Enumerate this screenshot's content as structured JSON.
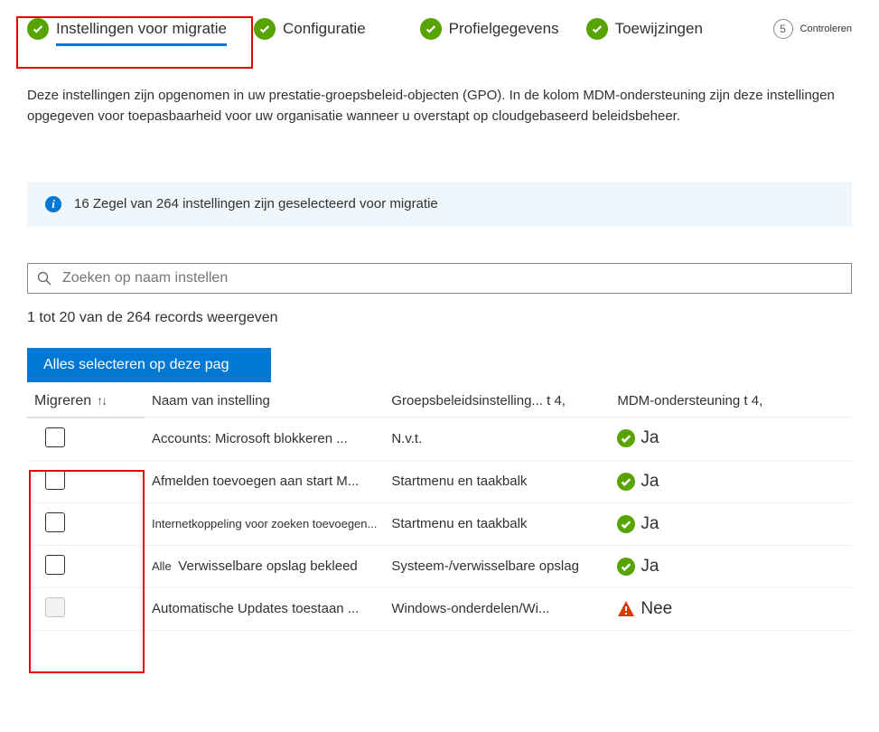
{
  "stepper": {
    "steps": [
      {
        "label": "Instellingen voor migratie",
        "done": true,
        "active": true
      },
      {
        "label": "Configuratie",
        "done": true
      },
      {
        "label": "Profielgegevens",
        "done": true
      },
      {
        "label": "Toewijzingen",
        "done": true
      },
      {
        "label": "Controleren",
        "number": "5"
      }
    ]
  },
  "description": "Deze instellingen zijn opgenomen in uw prestatie-groepsbeleid-objecten (GPO). In de kolom MDM-ondersteuning zijn deze instellingen opgegeven voor toepasbaarheid voor uw organisatie wanneer u overstapt op cloudgebaseerd beleidsbeheer.",
  "info": {
    "count": "16",
    "text": "Zegel van 264 instellingen zijn geselecteerd voor migratie"
  },
  "search": {
    "placeholder": "Zoeken op naam instellen"
  },
  "records_label": "1 tot 20 van de 264 records weergeven",
  "select_all_button": "Alles selecteren op deze pag",
  "columns": {
    "migrate": "Migreren",
    "name": "Naam van instelling",
    "gpo": "Groepsbeleidsinstelling... t 4,",
    "mdm": "MDM-ondersteuning t 4,"
  },
  "rows": [
    {
      "name": "Accounts: Microsoft blokkeren ...",
      "gpo": "N.v.t.",
      "mdm": "Ja",
      "mdm_ok": true,
      "checked": false
    },
    {
      "name": "Afmelden toevoegen aan start M...",
      "gpo": "Startmenu en taakbalk",
      "mdm": "Ja",
      "mdm_ok": true,
      "checked": false
    },
    {
      "name": "Internetkoppeling voor zoeken toevoegen...",
      "gpo": "Startmenu en taakbalk",
      "mdm": "Ja",
      "mdm_ok": true,
      "checked": false,
      "small": true
    },
    {
      "name": "Verwisselbare opslag bekleed",
      "prefix": "Alle",
      "gpo": "Systeem-/verwisselbare opslag",
      "mdm": "Ja",
      "mdm_ok": true,
      "checked": false
    },
    {
      "name": "Automatische Updates toestaan ...",
      "gpo": "Windows-onderdelen/Wi...",
      "mdm": "Nee",
      "mdm_ok": false,
      "checked": false,
      "disabled": true
    }
  ]
}
